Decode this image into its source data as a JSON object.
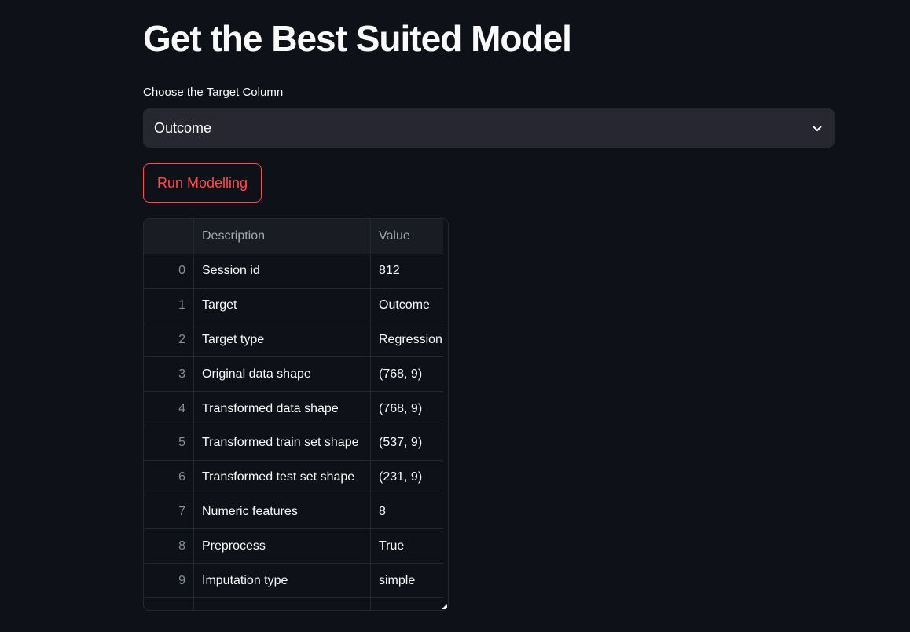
{
  "title": "Get the Best Suited Model",
  "target_select": {
    "label": "Choose the Target Column",
    "value": "Outcome"
  },
  "run_button": "Run Modelling",
  "table": {
    "columns": [
      "",
      "Description",
      "Value"
    ],
    "rows": [
      {
        "index": "0",
        "description": "Session id",
        "value": "812"
      },
      {
        "index": "1",
        "description": "Target",
        "value": "Outcome"
      },
      {
        "index": "2",
        "description": "Target type",
        "value": "Regression"
      },
      {
        "index": "3",
        "description": "Original data shape",
        "value": "(768, 9)"
      },
      {
        "index": "4",
        "description": "Transformed data shape",
        "value": "(768, 9)"
      },
      {
        "index": "5",
        "description": "Transformed train set shape",
        "value": "(537, 9)"
      },
      {
        "index": "6",
        "description": "Transformed test set shape",
        "value": "(231, 9)"
      },
      {
        "index": "7",
        "description": "Numeric features",
        "value": "8"
      },
      {
        "index": "8",
        "description": "Preprocess",
        "value": "True"
      },
      {
        "index": "9",
        "description": "Imputation type",
        "value": "simple"
      }
    ]
  }
}
